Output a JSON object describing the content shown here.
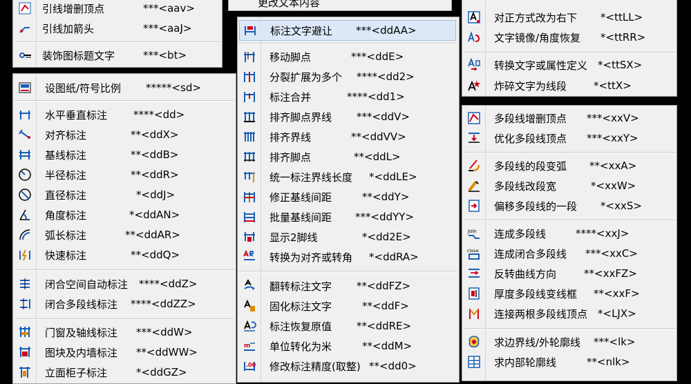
{
  "menu1": {
    "items": [
      {
        "label": "引线增删顶点",
        "shortcut": "***<aav>",
        "icon": "leader-vertex-icon"
      },
      {
        "label": "引线加箭头",
        "shortcut": "***<aaJ>",
        "icon": "leader-arrow-icon"
      },
      {
        "label": "装饰图标题文字",
        "shortcut": "***<bt>",
        "icon": "title-decor-icon"
      }
    ]
  },
  "menu_top_stub": {
    "label": "更改文本内容"
  },
  "menu2": {
    "items": [
      {
        "label": "设图纸/符号比例",
        "shortcut": "*****<sd>",
        "icon": "drawing-scale-icon"
      },
      {
        "label": "水平垂直标注",
        "shortcut": "****<dd>",
        "icon": "linear-dim-icon"
      },
      {
        "label": "对齐标注",
        "shortcut": "**<ddX>",
        "icon": "aligned-dim-icon"
      },
      {
        "label": "基线标注",
        "shortcut": "**<ddB>",
        "icon": "baseline-dim-icon"
      },
      {
        "label": "半径标注",
        "shortcut": "**<ddR>",
        "icon": "radius-dim-icon"
      },
      {
        "label": "直径标注",
        "shortcut": "*<ddJ>",
        "icon": "diameter-dim-icon"
      },
      {
        "label": "角度标注",
        "shortcut": "*<ddAN>",
        "icon": "angle-dim-icon"
      },
      {
        "label": "弧长标注",
        "shortcut": "**<ddAR>",
        "icon": "arc-length-dim-icon"
      },
      {
        "label": "快速标注",
        "shortcut": "**<ddQ>",
        "icon": "quick-dim-icon"
      },
      {
        "label": "闭合空间自动标注",
        "shortcut": "****<ddZ>",
        "icon": "closed-space-dim-icon"
      },
      {
        "label": "闭合多段线标注",
        "shortcut": "****<ddZZ>",
        "icon": "closed-pline-dim-icon"
      },
      {
        "label": "门窗及轴线标注",
        "shortcut": "***<ddW>",
        "icon": "door-window-axis-dim-icon"
      },
      {
        "label": "图块及内墙标注",
        "shortcut": "**<ddWW>",
        "icon": "block-wall-dim-icon"
      },
      {
        "label": "立面柜子标注",
        "shortcut": "*<ddGZ>",
        "icon": "elevation-cabinet-dim-icon"
      }
    ]
  },
  "menu3": {
    "items": [
      {
        "label": "标注文字避让",
        "shortcut": "***<ddAA>",
        "icon": "dim-text-avoid-icon"
      },
      {
        "label": "移动脚点",
        "shortcut": "***<ddE>",
        "icon": "move-foot-icon"
      },
      {
        "label": "分裂扩展为多个",
        "shortcut": "****<dd2>",
        "icon": "split-dim-icon"
      },
      {
        "label": "标注合并",
        "shortcut": "****<dd1>",
        "icon": "merge-dim-icon"
      },
      {
        "label": "排齐脚点界线",
        "shortcut": "***<ddV>",
        "icon": "align-foot-ext-icon"
      },
      {
        "label": "排齐界线",
        "shortcut": "**<ddVV>",
        "icon": "align-ext-icon"
      },
      {
        "label": "排齐脚点",
        "shortcut": "**<ddL>",
        "icon": "align-foot-icon"
      },
      {
        "label": "统一标注界线长度",
        "shortcut": "*<ddLE>",
        "icon": "unify-ext-length-icon"
      },
      {
        "label": "修正基线间距",
        "shortcut": "**<ddY>",
        "icon": "fix-baseline-spacing-icon"
      },
      {
        "label": "批量基线间距",
        "shortcut": "***<ddYY>",
        "icon": "batch-baseline-spacing-icon"
      },
      {
        "label": "显示2脚线",
        "shortcut": "*<dd2E>",
        "icon": "show-two-ext-icon"
      },
      {
        "label": "转换为对齐或转角",
        "shortcut": "*<ddRA>",
        "icon": "convert-aligned-rotated-icon"
      },
      {
        "label": "翻转标注文字",
        "shortcut": "**<ddFZ>",
        "icon": "flip-dim-text-icon"
      },
      {
        "label": "固化标注文字",
        "shortcut": "**<ddF>",
        "icon": "fix-dim-text-icon"
      },
      {
        "label": "标注恢复原值",
        "shortcut": "**<ddRE>",
        "icon": "restore-dim-value-icon"
      },
      {
        "label": "单位转化为米",
        "shortcut": "**<ddM>",
        "icon": "unit-to-meter-icon"
      },
      {
        "label": "修改标注精度(取整)",
        "shortcut": "**<dd0>",
        "icon": "dim-precision-icon"
      }
    ]
  },
  "menu4": {
    "items": [
      {
        "label": "对正方式改为右下",
        "shortcut": "*<ttLL>",
        "icon": "justify-bottom-right-icon"
      },
      {
        "label": "文字镜像/角度恢复",
        "shortcut": "*<ttRR>",
        "icon": "text-mirror-restore-icon"
      },
      {
        "label": "转换文字或属性定义",
        "shortcut": "*<ttSX>",
        "icon": "convert-text-attdef-icon"
      },
      {
        "label": "炸碎文字为线段",
        "shortcut": "*<ttX>",
        "icon": "explode-text-icon"
      }
    ]
  },
  "menu5": {
    "items": [
      {
        "label": "多段线增删顶点",
        "shortcut": "***<xxV>",
        "icon": "pline-vertex-edit-icon"
      },
      {
        "label": "优化多段线顶点",
        "shortcut": "***<xxY>",
        "icon": "pline-optimize-icon"
      },
      {
        "label": "多段线的段变弧",
        "shortcut": "**<xxA>",
        "icon": "pline-segment-arc-icon"
      },
      {
        "label": "多段线改段宽",
        "shortcut": "*<xxW>",
        "icon": "pline-segment-width-icon"
      },
      {
        "label": "偏移多段线的一段",
        "shortcut": "*<xxS>",
        "icon": "pline-offset-segment-icon"
      },
      {
        "label": "连成多段线",
        "shortcut": "****<xxJ>",
        "icon": "join-pline-icon"
      },
      {
        "label": "连成闭合多段线",
        "shortcut": "***<xxC>",
        "icon": "join-closed-pline-icon"
      },
      {
        "label": "反转曲线方向",
        "shortcut": "**<xxFZ>",
        "icon": "reverse-curve-icon"
      },
      {
        "label": "厚度多段线变线框",
        "shortcut": "**<xxF>",
        "icon": "thick-pline-outline-icon"
      },
      {
        "label": "连接两根多段线顶点",
        "shortcut": "*<LJX>",
        "icon": "connect-pline-vertices-icon"
      },
      {
        "label": "求边界线/外轮廓线",
        "shortcut": "***<lk>",
        "icon": "boundary-outline-icon"
      },
      {
        "label": "求内部轮廓线",
        "shortcut": "**<nlk>",
        "icon": "inner-outline-icon"
      }
    ]
  },
  "colors": {
    "menu_bg": "#f0f0f0",
    "highlight_bg": "#dce8f7",
    "highlight_border": "#9cbde0",
    "separator": "#c8c8c8",
    "icon_blue": "#1a5fb4",
    "icon_red": "#d0021b",
    "icon_orange": "#e08a00",
    "backdrop": "#000000"
  }
}
